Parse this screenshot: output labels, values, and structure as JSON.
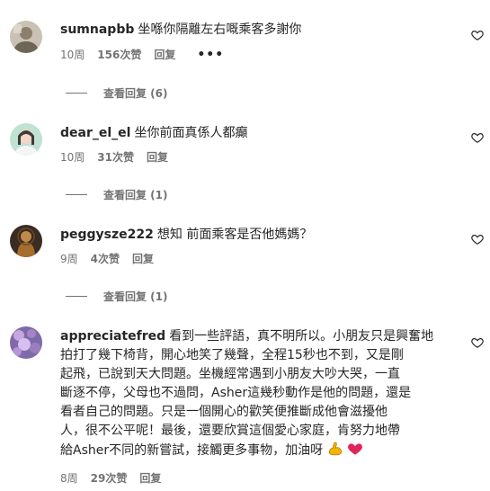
{
  "comments": [
    {
      "username": "sumnapbb",
      "text": "坐喺你隔離左右嘅乘客多謝你",
      "age": "10周",
      "likes": "156次赞",
      "reply": "回复",
      "more": "•••",
      "view_replies": "查看回复 (6)"
    },
    {
      "username": "dear_el_el",
      "text": "坐你前面真係人都癲",
      "age": "10周",
      "likes": "31次赞",
      "reply": "回复",
      "view_replies": "查看回复 (1)"
    },
    {
      "username": "peggysze222",
      "text": "想知 前面乘客是否他媽媽？",
      "age": "9周",
      "likes": "4次赞",
      "reply": "回复",
      "view_replies": "查看回复 (1)"
    },
    {
      "username": "appreciatefred",
      "lines": [
        "看到一些評語，真不明所以。小朋友只是興奮地",
        "拍打了幾下椅背，開心地笑了幾聲，全程15秒也不到，又是剛",
        "起飛，已說到天大問題。坐機經常遇到小朋友大吵大哭，一直",
        "斷逐不停，父母也不過問，Asher這幾秒動作是他的問題，還是",
        "看者自己的問題。只是一個開心的歡笑便推斷成他會滋擾他",
        "人，很不公平呢！最後，還要欣賞這個愛心家庭，肯努力地帶",
        "給Asher不同的新嘗試，接觸更多事物，加油呀"
      ],
      "age": "8周",
      "likes": "29次赞",
      "reply": "回复"
    }
  ],
  "colors": {
    "text": "#262626",
    "meta": "#737373",
    "emoji_heart": "#e0245e",
    "emoji_muscle": "#f4b400"
  },
  "icons": [
    "heart-outline-icon",
    "flexed-biceps-emoji",
    "red-heart-emoji"
  ]
}
